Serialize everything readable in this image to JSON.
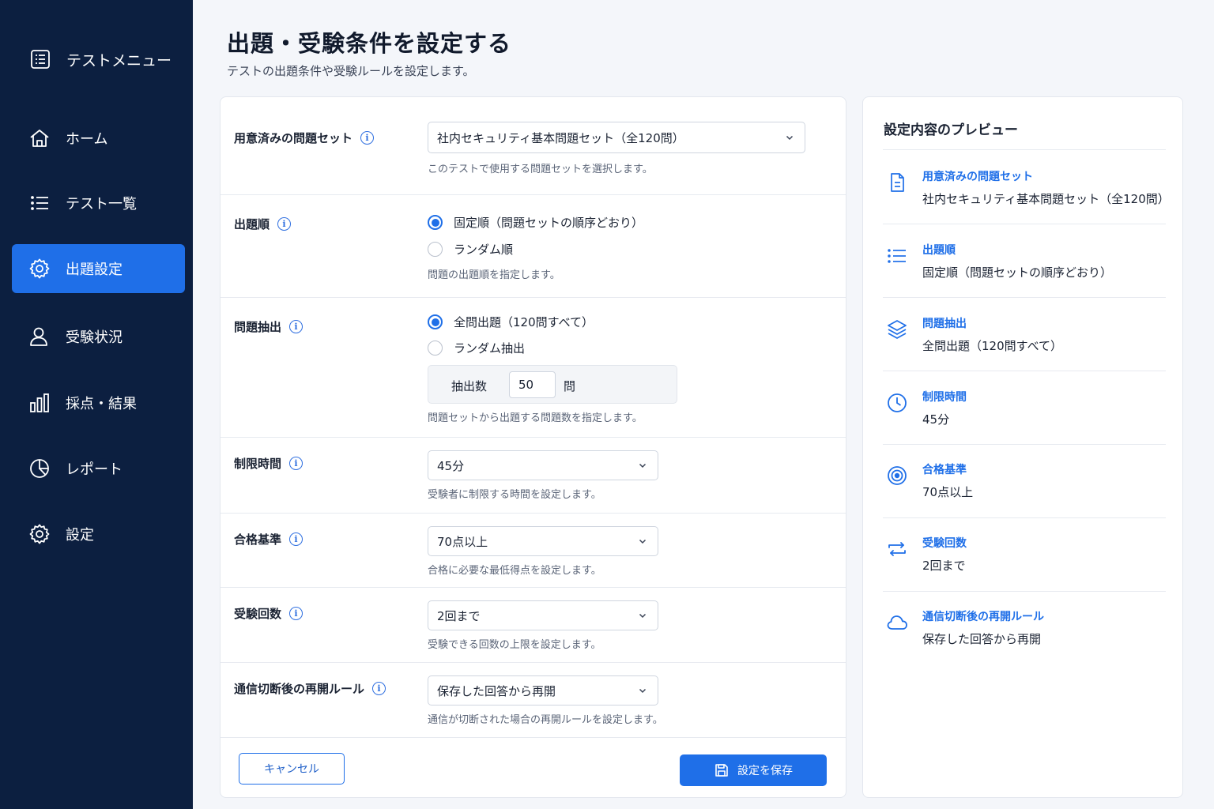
{
  "sidebar": {
    "header": "テストメニュー",
    "items": [
      {
        "label": "ホーム",
        "icon": "home-icon"
      },
      {
        "label": "テスト一覧",
        "icon": "list-icon"
      },
      {
        "label": "出題設定",
        "icon": "gear-icon",
        "active": true
      },
      {
        "label": "受験状況",
        "icon": "user-icon"
      },
      {
        "label": "採点・結果",
        "icon": "bar-chart-icon"
      },
      {
        "label": "レポート",
        "icon": "pie-chart-icon"
      },
      {
        "label": "設定",
        "icon": "gear-icon"
      }
    ]
  },
  "page": {
    "title": "出題・受験条件を設定する",
    "subtitle": "テストの出題条件や受験ルールを設定します。"
  },
  "form": {
    "question_set": {
      "label": "用意済みの問題セット",
      "value": "社内セキュリティ基本問題セット（全120問）",
      "help": "このテストで使用する問題セットを選択します。"
    },
    "order": {
      "label": "出題順",
      "options": [
        "固定順（問題セットの順序どおり）",
        "ランダム順"
      ],
      "selected": 0,
      "help": "問題の出題順を指定します。"
    },
    "extraction": {
      "label": "問題抽出",
      "options": [
        "全問出題（120問すべて）",
        "ランダム抽出"
      ],
      "selected": 0,
      "count_label": "抽出数",
      "count_value": "50",
      "count_unit": "問",
      "help": "問題セットから出題する問題数を指定します。"
    },
    "time_limit": {
      "label": "制限時間",
      "value": "45分",
      "help": "受験者に制限する時間を設定します。"
    },
    "pass_criteria": {
      "label": "合格基準",
      "value": "70点以上",
      "help": "合格に必要な最低得点を設定します。"
    },
    "attempts": {
      "label": "受験回数",
      "value": "2回まで",
      "help": "受験できる回数の上限を設定します。"
    },
    "resume_rule": {
      "label": "通信切断後の再開ルール",
      "value": "保存した回答から再開",
      "help": "通信が切断された場合の再開ルールを設定します。"
    },
    "cancel_label": "キャンセル",
    "save_label": "設定を保存"
  },
  "preview": {
    "title": "設定内容のプレビュー",
    "items": [
      {
        "label": "用意済みの問題セット",
        "value": "社内セキュリティ基本問題セット（全120問）",
        "icon": "document-icon"
      },
      {
        "label": "出題順",
        "value": "固定順（問題セットの順序どおり）",
        "icon": "list-icon"
      },
      {
        "label": "問題抽出",
        "value": "全問出題（120問すべて）",
        "icon": "layers-icon"
      },
      {
        "label": "制限時間",
        "value": "45分",
        "icon": "clock-icon"
      },
      {
        "label": "合格基準",
        "value": "70点以上",
        "icon": "target-icon"
      },
      {
        "label": "受験回数",
        "value": "2回まで",
        "icon": "repeat-icon"
      },
      {
        "label": "通信切断後の再開ルール",
        "value": "保存した回答から再開",
        "icon": "cloud-icon"
      }
    ]
  },
  "colors": {
    "sidebar_bg": "#0c1f40",
    "accent": "#1f6fe8"
  }
}
